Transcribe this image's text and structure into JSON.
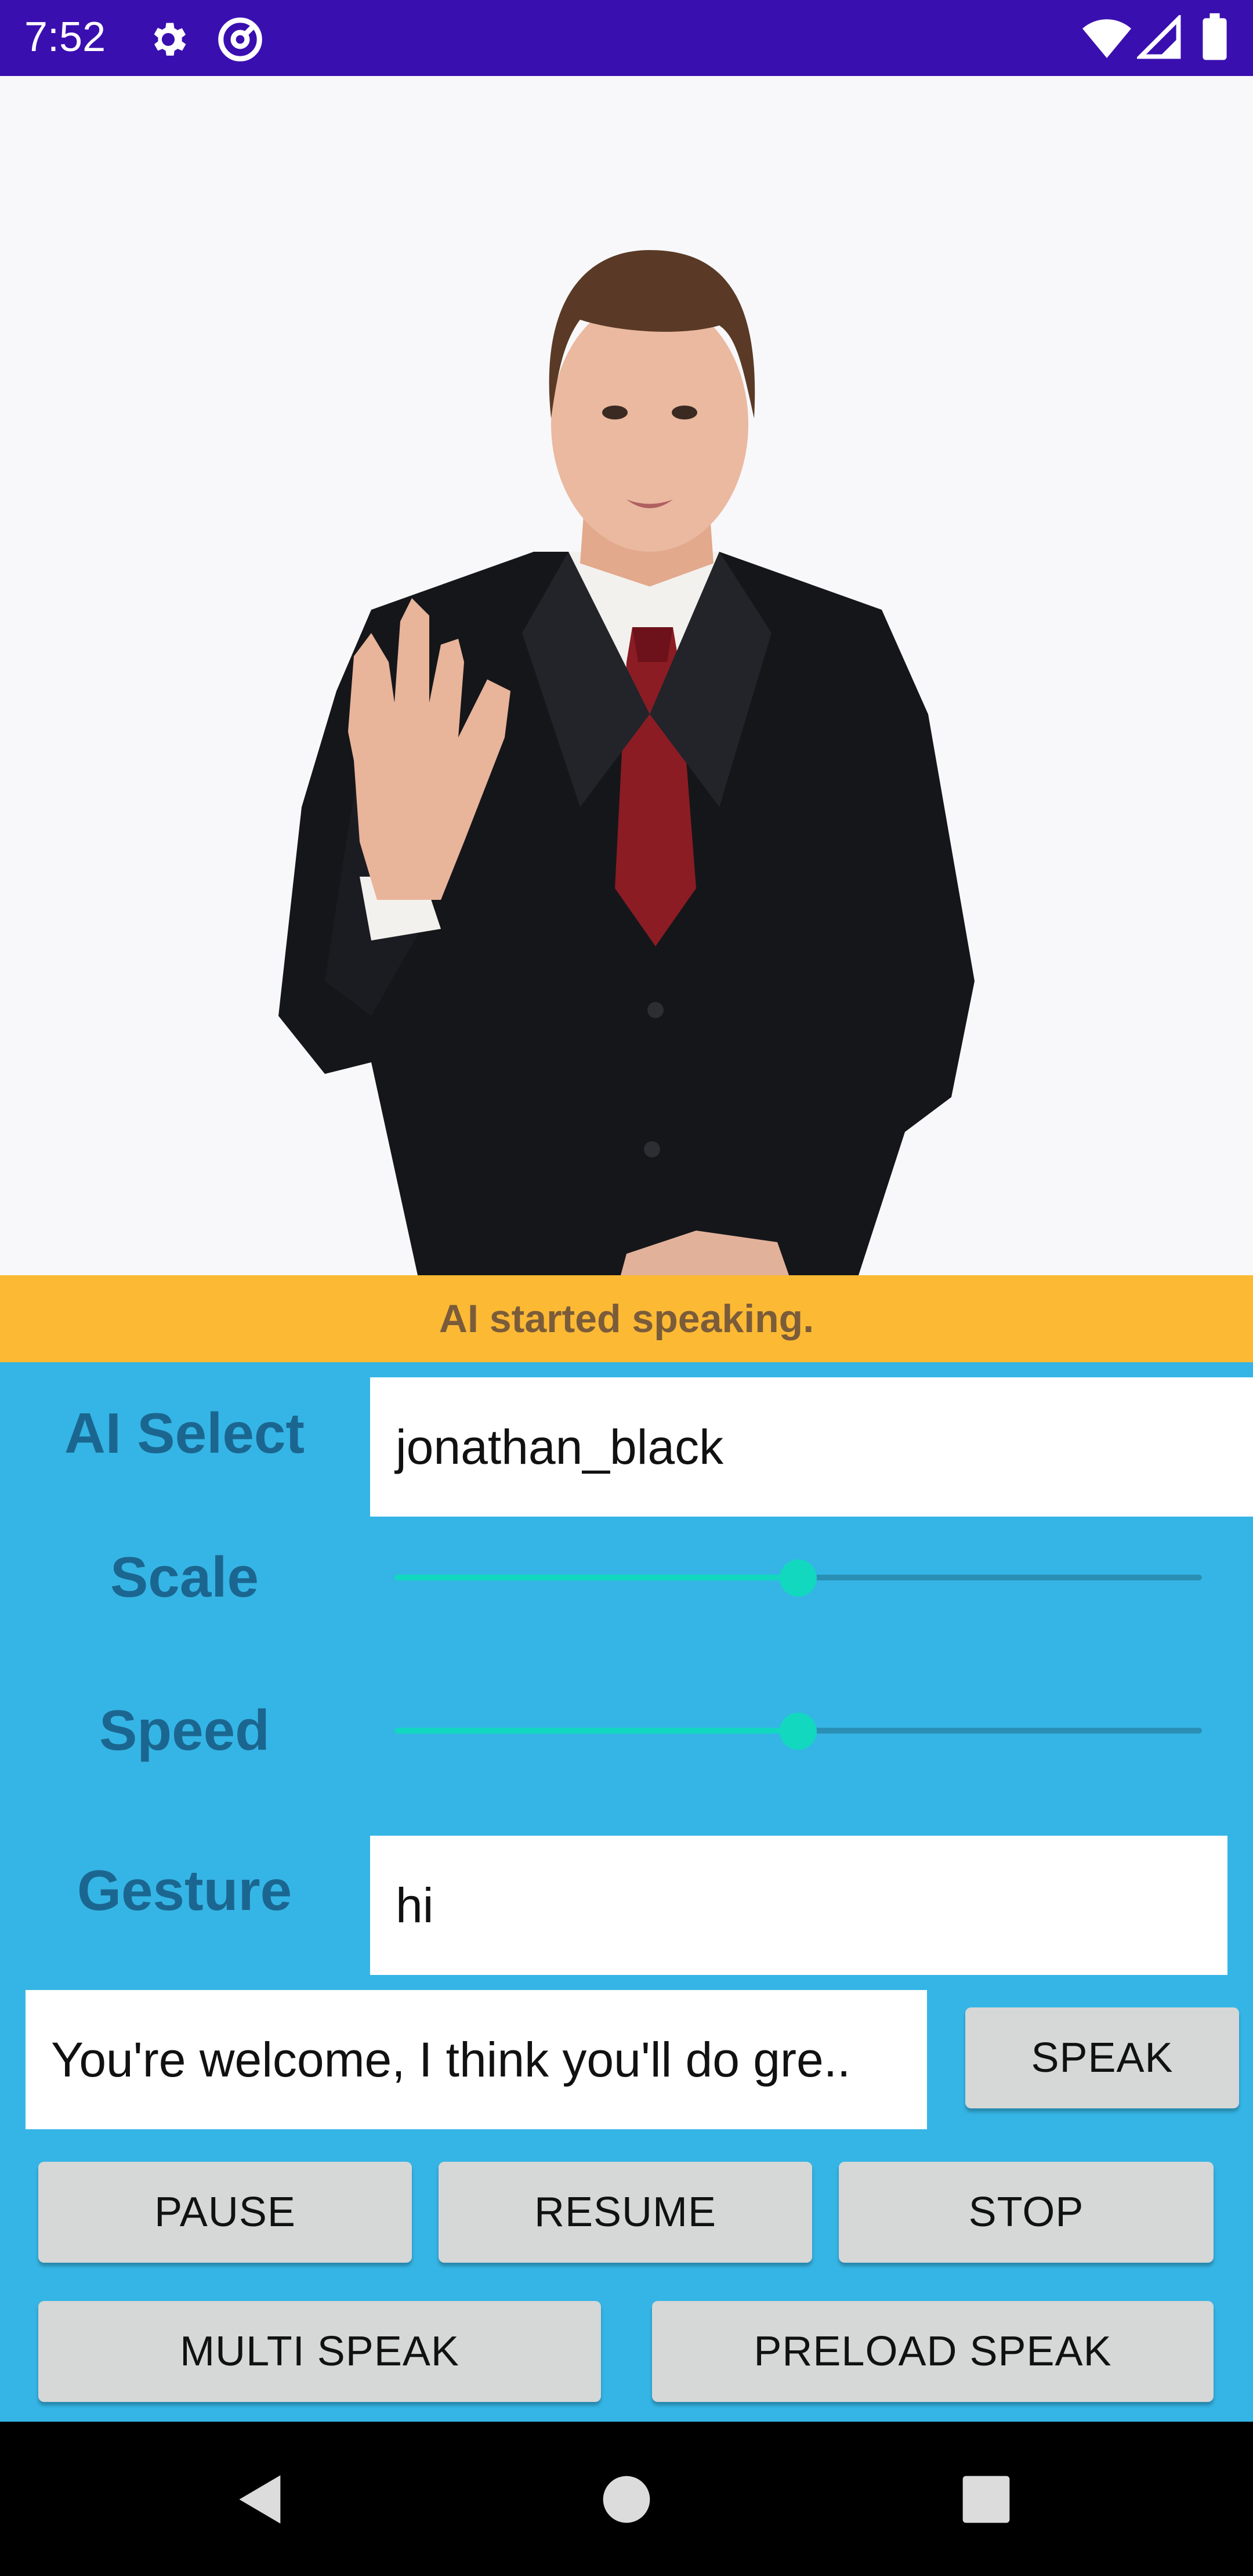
{
  "status_bar": {
    "time": "7:52",
    "icons": [
      "gear-icon",
      "at-sign-icon",
      "wifi-icon",
      "signal-icon",
      "battery-icon"
    ],
    "background": "#3a0fb0"
  },
  "avatar": {
    "description_icon": "ai-presenter-avatar"
  },
  "banner": {
    "text": "AI started speaking.",
    "color": "#fcb934"
  },
  "controls": {
    "ai_select": {
      "label": "AI Select",
      "value": "jonathan_black"
    },
    "scale": {
      "label": "Scale",
      "value": 0.5
    },
    "speed": {
      "label": "Speed",
      "value": 0.5
    },
    "gesture": {
      "label": "Gesture",
      "value": "hi"
    },
    "speak_text": {
      "value": "You're welcome, I think you'll do gre.."
    },
    "speak_button": "SPEAK",
    "pause_button": "PAUSE",
    "resume_button": "RESUME",
    "stop_button": "STOP",
    "multi_speak_button": "MULTI SPEAK",
    "preload_speak_button": "PRELOAD SPEAK"
  },
  "colors": {
    "panel": "#35b5e5",
    "label": "#1b6690",
    "slider": "#12d8c0"
  },
  "nav_bar": {
    "icons": [
      "back-icon",
      "home-icon",
      "recents-icon"
    ]
  }
}
